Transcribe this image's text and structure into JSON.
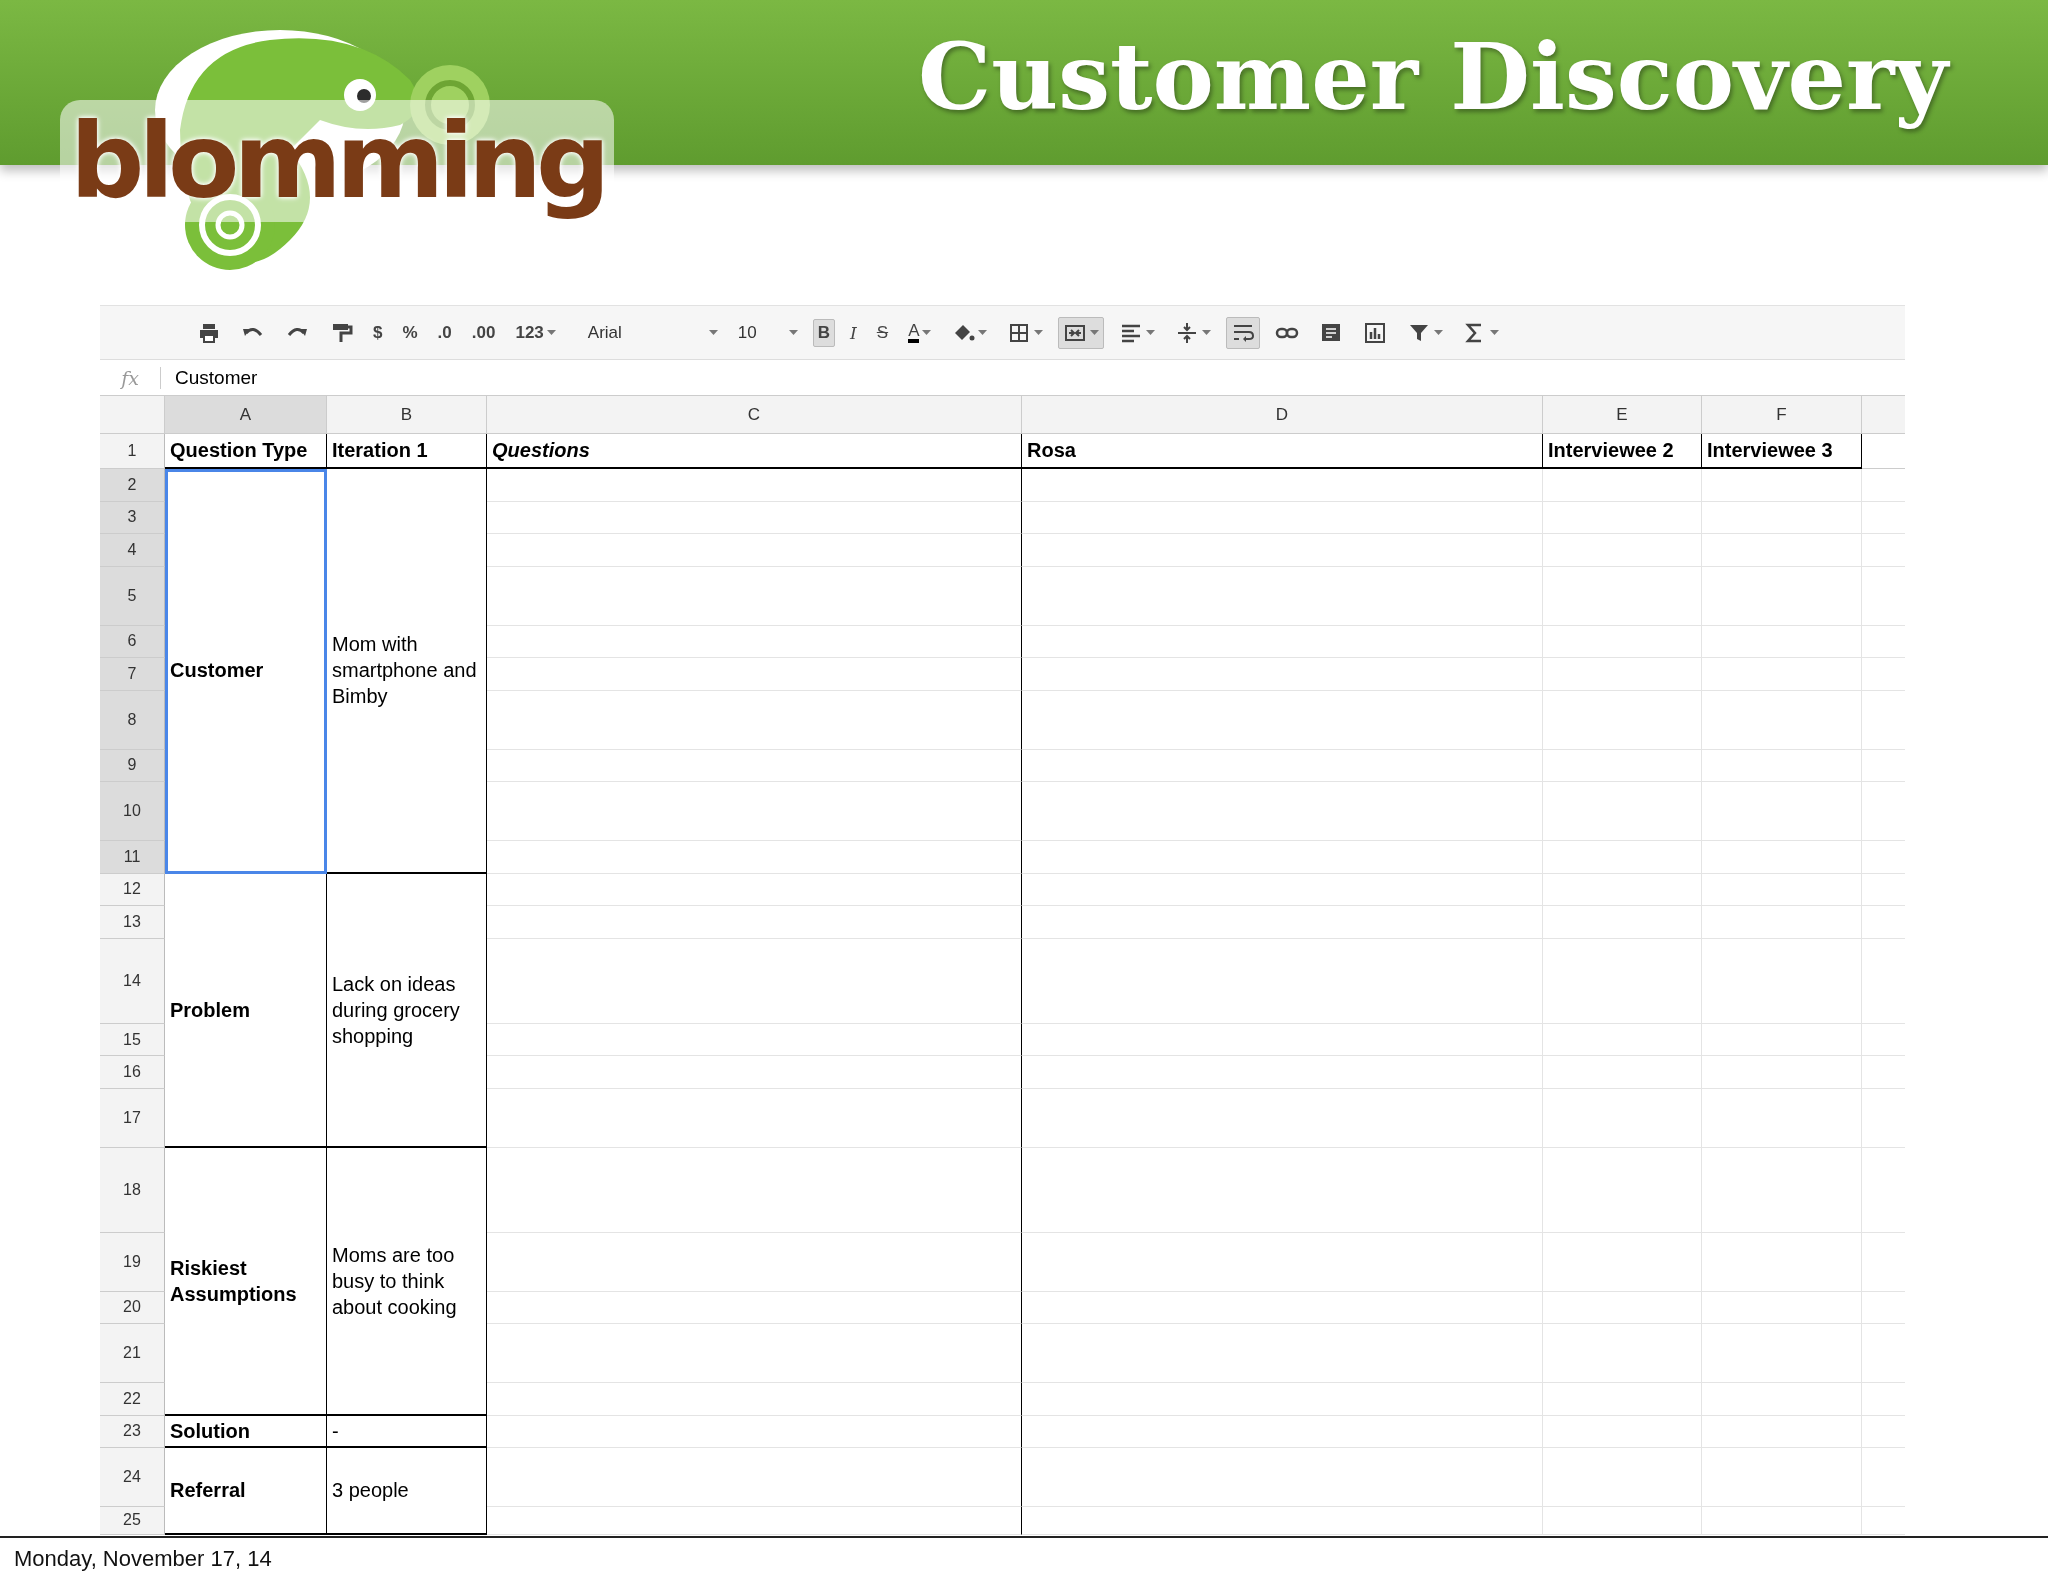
{
  "slide": {
    "title": "Customer Discovery",
    "logo": "blomming",
    "footer": "Monday, November 17, 14"
  },
  "toolbar": [
    {
      "kind": "print"
    },
    {
      "kind": "undo"
    },
    {
      "kind": "redo"
    },
    {
      "kind": "paint"
    },
    {
      "kind": "text",
      "label": "$"
    },
    {
      "kind": "text",
      "label": "%"
    },
    {
      "kind": "text",
      "label": ".0"
    },
    {
      "kind": "text",
      "label": ".00"
    },
    {
      "kind": "dropdown",
      "label": "123"
    },
    {
      "kind": "font",
      "label": "Arial"
    },
    {
      "kind": "size",
      "label": "10"
    },
    {
      "kind": "bold",
      "label": "B",
      "selected": true
    },
    {
      "kind": "italic",
      "label": "I",
      "selected": false
    },
    {
      "kind": "strike",
      "label": "S",
      "selected": false
    },
    {
      "kind": "color",
      "label": "A"
    },
    {
      "kind": "fill"
    },
    {
      "kind": "borders"
    },
    {
      "kind": "merge",
      "selected": true
    },
    {
      "kind": "align"
    },
    {
      "kind": "valign"
    },
    {
      "kind": "wrap",
      "selected": true
    },
    {
      "kind": "link"
    },
    {
      "kind": "comment"
    },
    {
      "kind": "chart"
    },
    {
      "kind": "filter"
    },
    {
      "kind": "sum"
    }
  ],
  "formula_bar": {
    "label": "fx",
    "value": "Customer"
  },
  "columns": [
    {
      "label": "A",
      "selected": true
    },
    {
      "label": "B",
      "selected": false
    },
    {
      "label": "C",
      "selected": false
    },
    {
      "label": "D",
      "selected": false
    },
    {
      "label": "E",
      "selected": false
    },
    {
      "label": "F",
      "selected": false
    }
  ],
  "header_row": {
    "number": "1",
    "cells": [
      {
        "text": "Question Type",
        "italic": false
      },
      {
        "text": "Iteration 1",
        "italic": false
      },
      {
        "text": "Questions",
        "italic": true
      },
      {
        "text": "Rosa",
        "italic": false
      },
      {
        "text": "Interviewee 2",
        "italic": false
      },
      {
        "text": "Interviewee 3",
        "italic": false
      }
    ]
  },
  "groups": [
    {
      "question_type": "Customer",
      "iteration": "Mom with smartphone and Bimby",
      "selected": true,
      "rows": [
        {
          "number": "2",
          "selected": true
        },
        {
          "number": "3",
          "selected": true
        },
        {
          "number": "4",
          "selected": true
        },
        {
          "number": "5",
          "selected": true
        },
        {
          "number": "6",
          "selected": true
        },
        {
          "number": "7",
          "selected": true
        },
        {
          "number": "8",
          "selected": true
        },
        {
          "number": "9",
          "selected": true
        },
        {
          "number": "10",
          "selected": true
        },
        {
          "number": "11",
          "selected": true
        }
      ]
    },
    {
      "question_type": "Problem",
      "iteration": "Lack on ideas during grocery shopping",
      "selected": false,
      "rows": [
        {
          "number": "12",
          "selected": false
        },
        {
          "number": "13",
          "selected": false
        },
        {
          "number": "14",
          "selected": false
        },
        {
          "number": "15",
          "selected": false
        },
        {
          "number": "16",
          "selected": false
        },
        {
          "number": "17",
          "selected": false
        }
      ]
    },
    {
      "question_type": "Riskiest Assumptions",
      "iteration": "Moms are too busy to think about cooking",
      "selected": false,
      "rows": [
        {
          "number": "18",
          "selected": false
        },
        {
          "number": "19",
          "selected": false
        },
        {
          "number": "20",
          "selected": false
        },
        {
          "number": "21",
          "selected": false
        },
        {
          "number": "22",
          "selected": false
        }
      ]
    },
    {
      "question_type": "Solution",
      "iteration": "-",
      "selected": false,
      "rows": [
        {
          "number": "23",
          "selected": false
        }
      ]
    },
    {
      "question_type": "Referral",
      "iteration": "3 people",
      "selected": false,
      "rows": [
        {
          "number": "24",
          "selected": false
        },
        {
          "number": "25",
          "selected": false
        }
      ]
    }
  ]
}
